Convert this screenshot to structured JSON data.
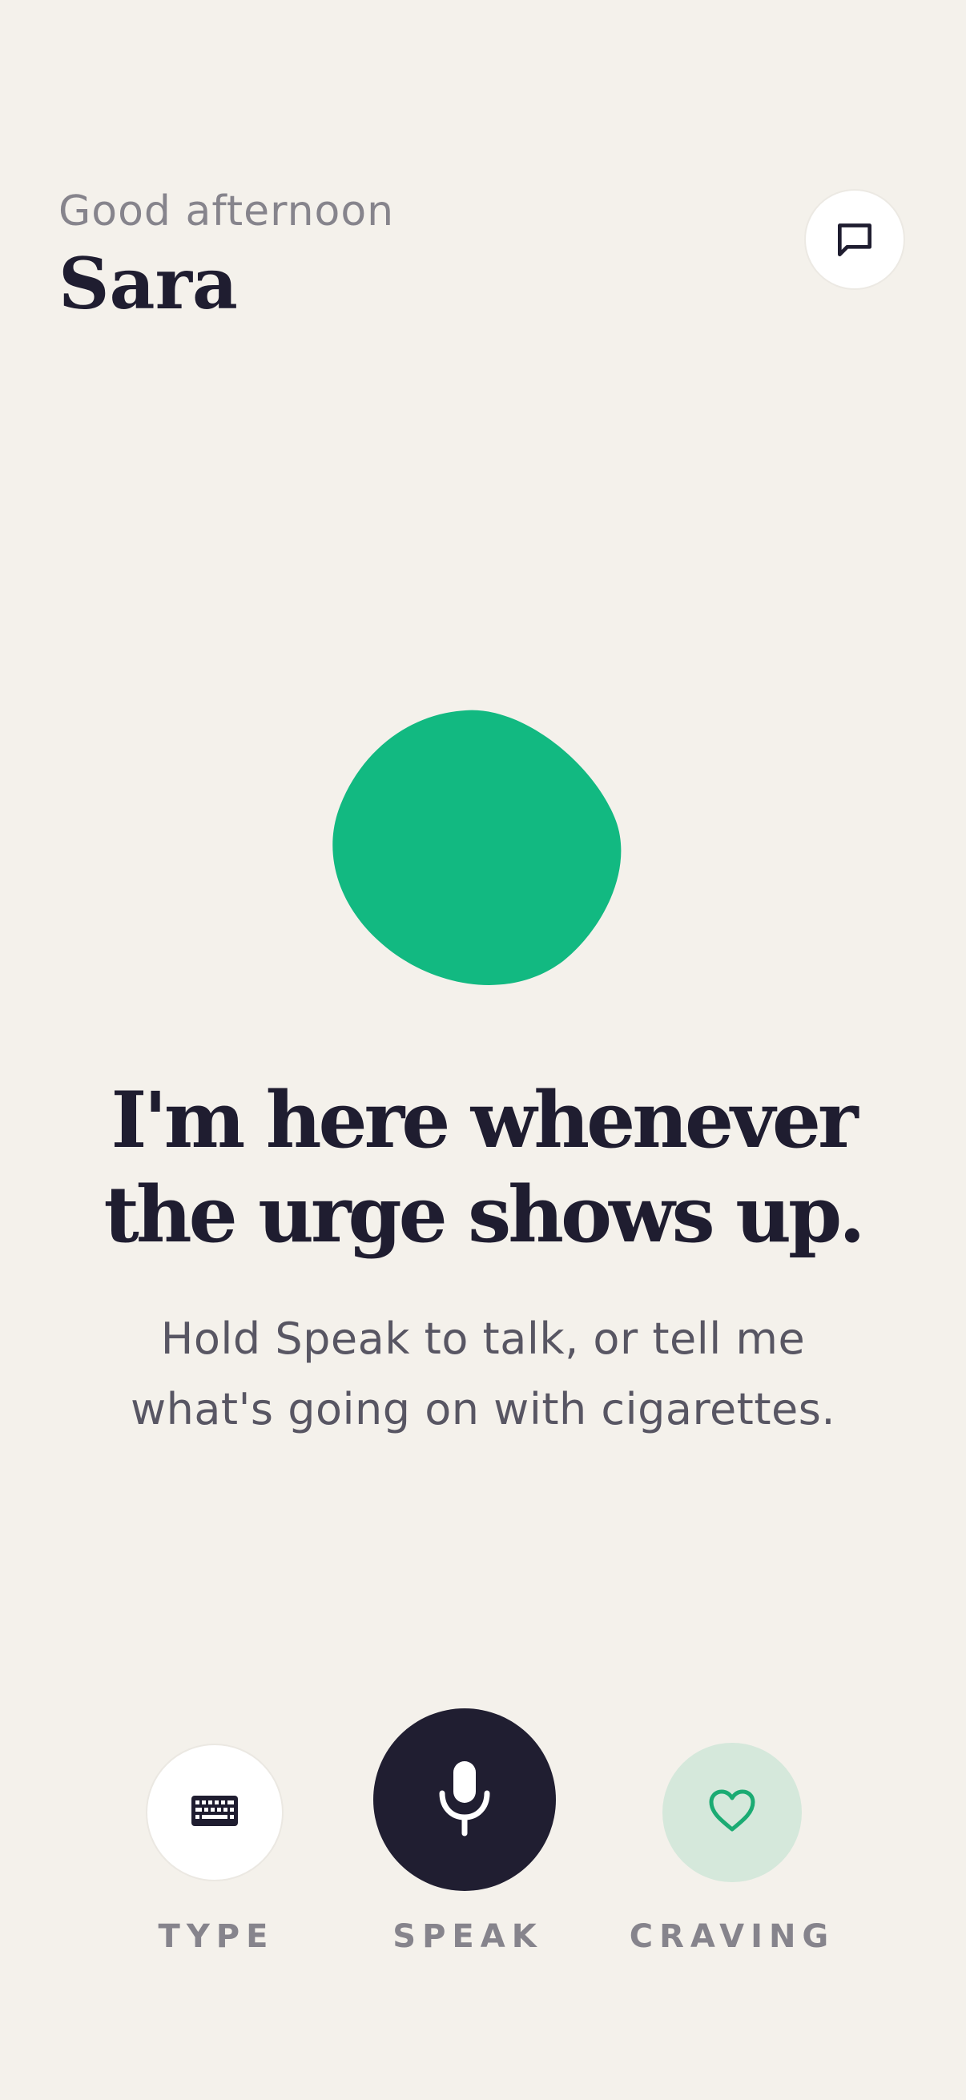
{
  "header": {
    "greeting": "Good afternoon",
    "user_name": "Sara",
    "chat_icon": "chat-bubble-icon"
  },
  "hero": {
    "blob_color": "#12b981",
    "headline_line1": "I'm here whenever",
    "headline_line2": "the urge shows up.",
    "subtext_line1": "Hold Speak to talk, or tell me",
    "subtext_line2": "what's going on with cigarettes."
  },
  "actions": {
    "type": {
      "label": "TYPE",
      "icon": "keyboard-icon"
    },
    "speak": {
      "label": "SPEAK",
      "icon": "microphone-icon"
    },
    "craving": {
      "label": "CRAVING",
      "icon": "heart-icon"
    }
  },
  "colors": {
    "background": "#f4f1eb",
    "text_primary": "#1f1d30",
    "text_secondary": "#585663",
    "text_muted": "#86848c",
    "accent_green": "#12b981",
    "craving_bg": "#d5e8db",
    "speak_bg": "#201e31"
  }
}
